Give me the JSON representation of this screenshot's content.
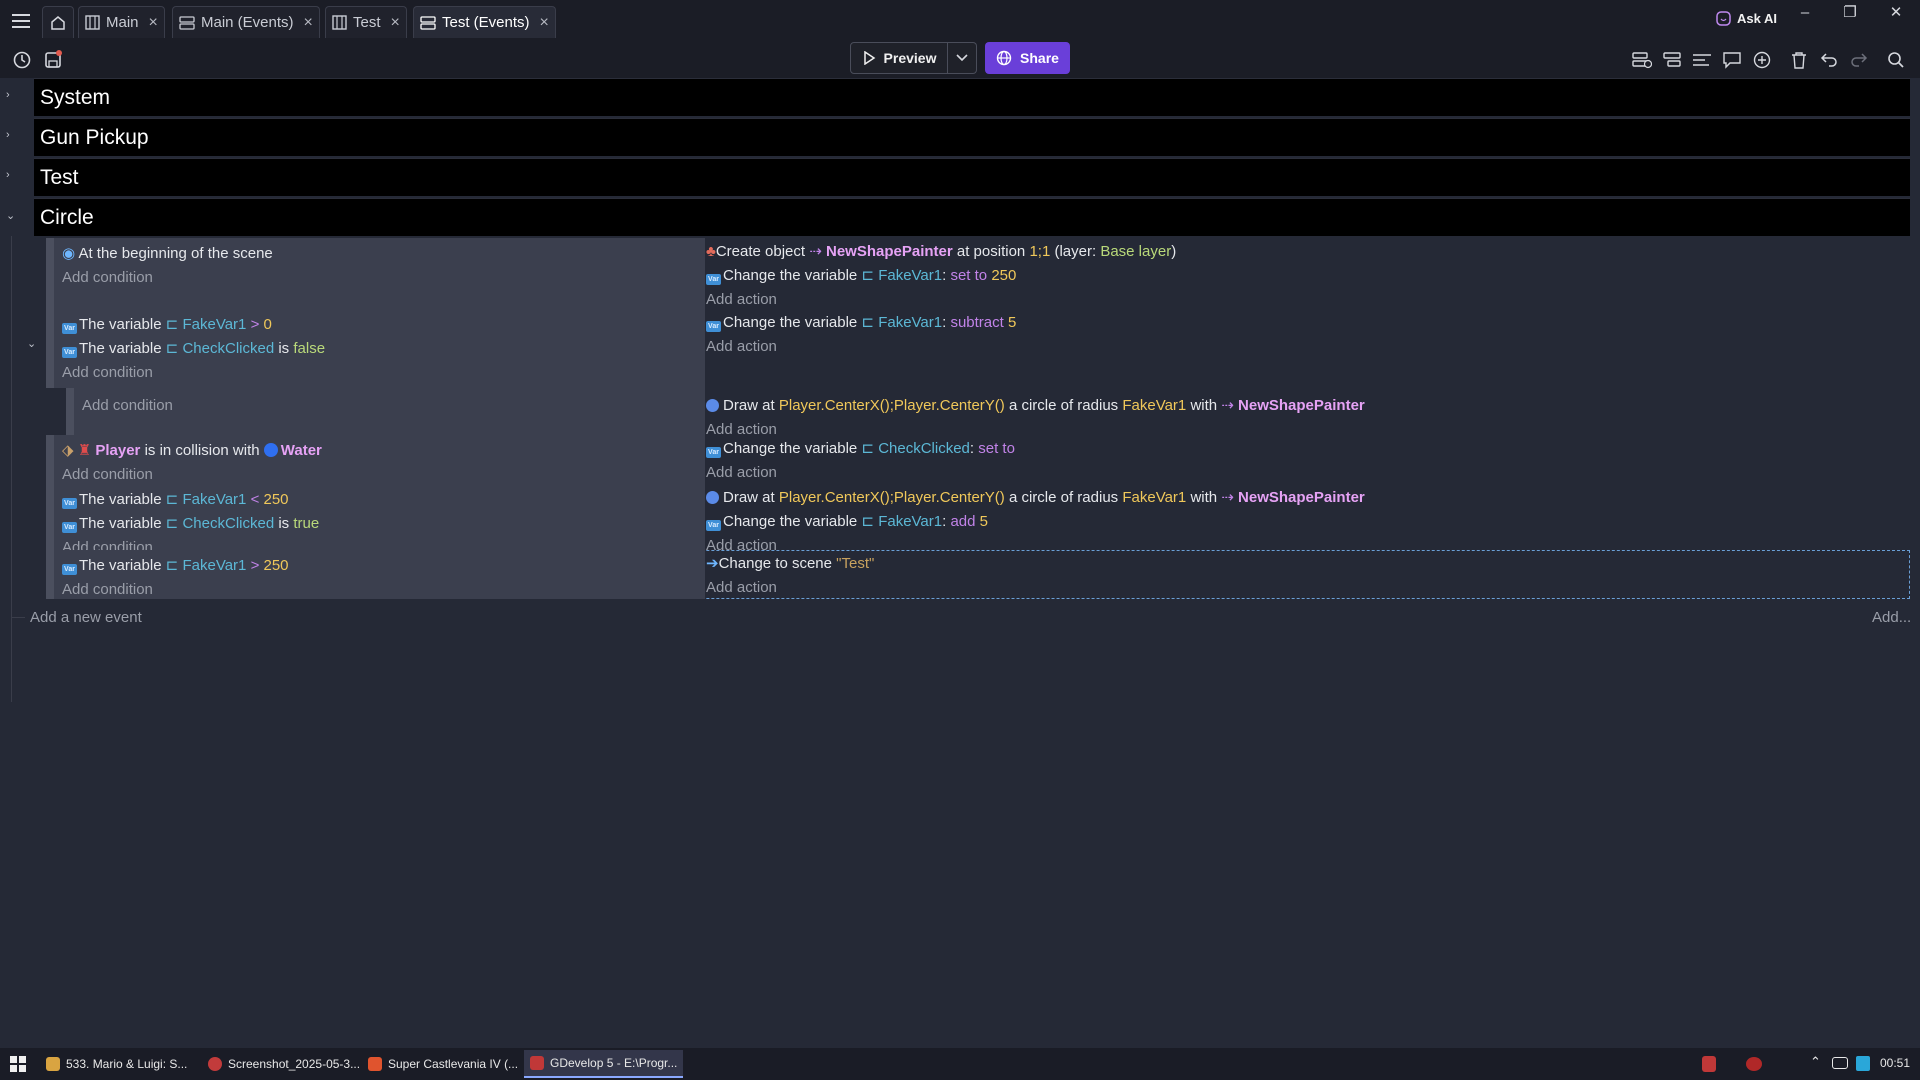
{
  "tabs": [
    {
      "label": "Main",
      "icon": "scene-icon"
    },
    {
      "label": "Main (Events)",
      "icon": "events-icon"
    },
    {
      "label": "Test",
      "icon": "scene-icon"
    },
    {
      "label": "Test (Events)",
      "icon": "events-icon",
      "active": true
    }
  ],
  "titlebar": {
    "ask_ai": "Ask AI"
  },
  "toolbar": {
    "preview": "Preview",
    "share": "Share",
    "share_color": "#6a3fd9"
  },
  "groups": [
    "System",
    "Gun Pickup",
    "Test",
    "Circle"
  ],
  "events": {
    "e1": {
      "cond": "At the beginning of the scene",
      "add_condition": "Add condition",
      "act1": {
        "prefix": "Create object",
        "object": "NewShapePainter",
        "mid": "at position",
        "pos": "1;1",
        "layer_pre": "(layer:",
        "layer": "Base layer",
        "layer_post": ")"
      },
      "act2": {
        "prefix": "Change the variable",
        "var": "FakeVar1",
        "op": "set to",
        "val": "250"
      },
      "add_action": "Add action"
    },
    "e2": {
      "c1": {
        "prefix": "The variable",
        "var": "FakeVar1",
        "op": ">",
        "val": "0"
      },
      "c2": {
        "prefix": "The variable",
        "var": "CheckClicked",
        "op": "is",
        "val": "false"
      },
      "add_condition": "Add condition",
      "act1": {
        "prefix": "Change the variable",
        "var": "FakeVar1",
        "op": "subtract",
        "val": "5"
      },
      "add_action": "Add action"
    },
    "e3": {
      "add_condition": "Add condition",
      "act1": {
        "prefix": "Draw at",
        "pos": "Player.CenterX();Player.CenterY()",
        "mid": "a circle of radius",
        "radius": "FakeVar1",
        "with": "with",
        "object": "NewShapePainter"
      },
      "add_action": "Add action"
    },
    "e4": {
      "c1": {
        "object": "Player",
        "mid": "is in collision with",
        "target": "Water"
      },
      "add_condition": "Add condition",
      "act1": {
        "prefix": "Change the variable",
        "var": "CheckClicked",
        "op": "set to",
        "val": "true"
      },
      "add_action": "Add action"
    },
    "e5": {
      "c1": {
        "prefix": "The variable",
        "var": "FakeVar1",
        "op": "<",
        "val": "250"
      },
      "c2": {
        "prefix": "The variable",
        "var": "CheckClicked",
        "op": "is",
        "val": "true"
      },
      "add_condition": "Add condition",
      "act1": {
        "prefix": "Draw at",
        "pos": "Player.CenterX();Player.CenterY()",
        "mid": "a circle of radius",
        "radius": "FakeVar1",
        "with": "with",
        "object": "NewShapePainter"
      },
      "act2": {
        "prefix": "Change the variable",
        "var": "FakeVar1",
        "op": "add",
        "val": "5"
      },
      "add_action": "Add action"
    },
    "e6": {
      "c1": {
        "prefix": "The variable",
        "var": "FakeVar1",
        "op": ">",
        "val": "250"
      },
      "add_condition": "Add condition",
      "act1": {
        "prefix": "Change to scene",
        "scene": "\"Test\""
      },
      "add_action": "Add action"
    }
  },
  "sheet": {
    "add_event": "Add a new event",
    "add_more": "Add..."
  },
  "taskbar": {
    "items": [
      "533. Mario & Luigi: S...",
      "Screenshot_2025-05-3...",
      "Super Castlevania IV (...",
      "GDevelop 5 - E:\\Progr..."
    ],
    "clock": "00:51"
  }
}
